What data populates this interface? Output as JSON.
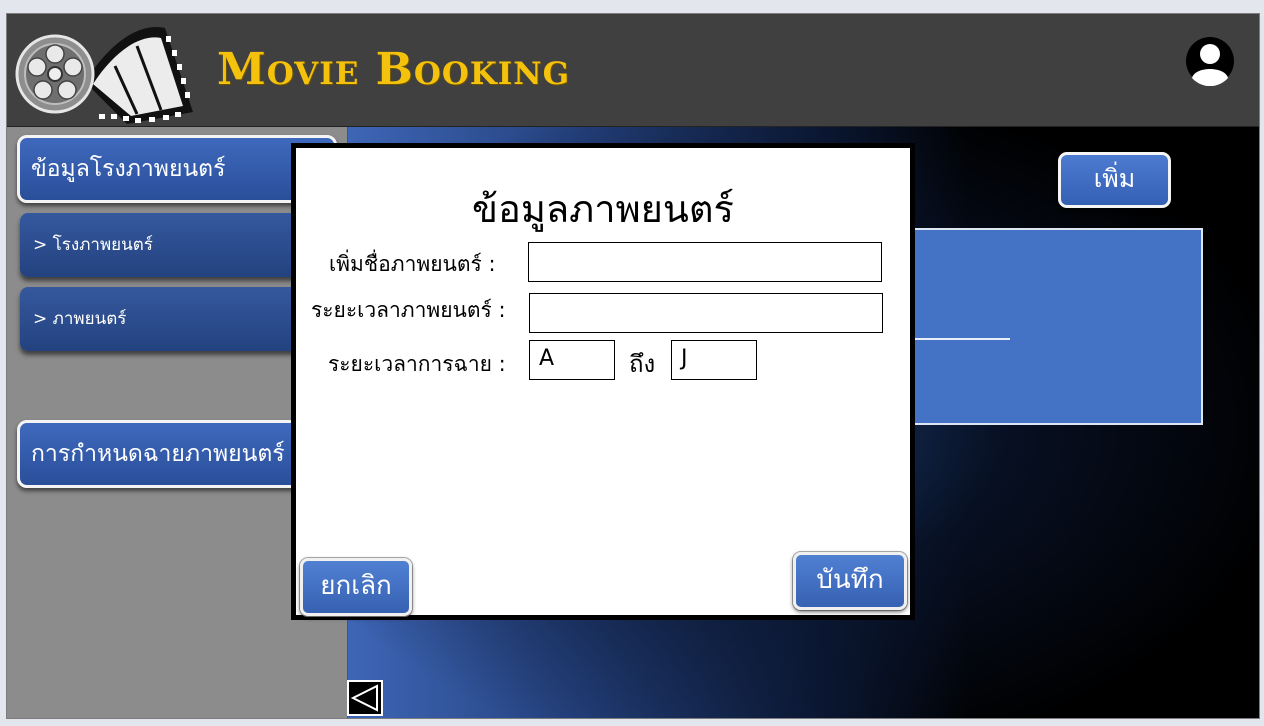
{
  "header": {
    "title": "Movie Booking",
    "logo_icon": "film-reel-icon",
    "user_icon": "user-avatar-icon"
  },
  "sidebar": {
    "items": [
      {
        "label": "ข้อมูลโรงภาพยนตร์"
      },
      {
        "label": "> โรงภาพยนตร์"
      },
      {
        "label": "> ภาพยนตร์"
      },
      {
        "label": "การกำหนดฉายภาพยนตร์"
      }
    ]
  },
  "main": {
    "add_label": "เพิ่ม",
    "back_icon": "triangle-left-icon"
  },
  "modal": {
    "title": "ข้อมูลภาพยนตร์",
    "fields": {
      "name_label": "เพิ่มชื่อภาพยนตร์ :",
      "name_value": "",
      "duration_label": "ระยะเวลาภาพยนตร์ :",
      "duration_value": "",
      "showtime_label": "ระยะเวลาการฉาย :",
      "showtime_from": "A",
      "showtime_to_label": "ถึง",
      "showtime_to": "J"
    },
    "cancel_label": "ยกเลิก",
    "save_label": "บันทึก"
  },
  "colors": {
    "title_gold": "#f4c20d",
    "header_bg": "#404040",
    "sidebar_bg": "#8c8c8c",
    "button_blue": "#4472c4"
  }
}
